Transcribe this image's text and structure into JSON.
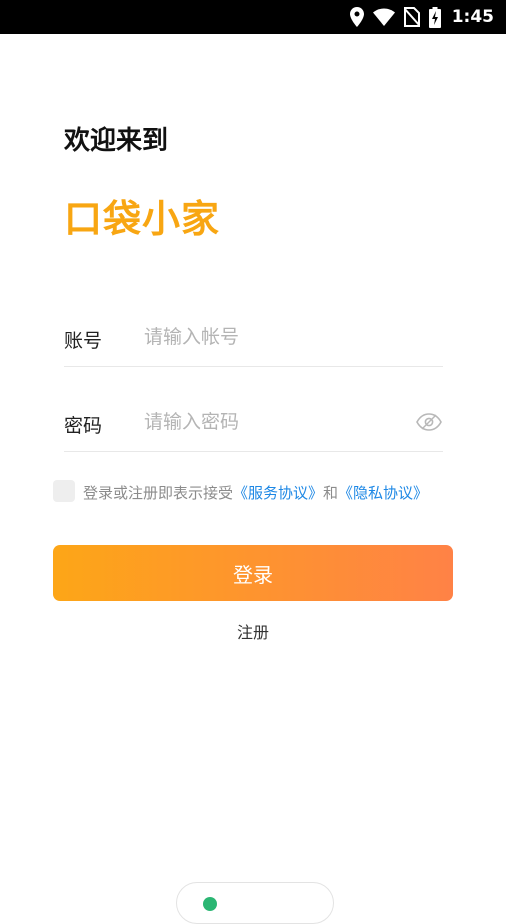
{
  "status_bar": {
    "time": "1:45",
    "icons": [
      "location-icon",
      "wifi-icon",
      "no-sim-icon",
      "battery-charging-icon"
    ]
  },
  "welcome_text": "欢迎来到",
  "app_name": "口袋小家",
  "form": {
    "account": {
      "label": "账号",
      "placeholder": "请输入帐号",
      "value": ""
    },
    "password": {
      "label": "密码",
      "placeholder": "请输入密码",
      "value": "",
      "visibility_icon": "eye-icon"
    }
  },
  "agreement": {
    "checked": false,
    "prefix": "登录或注册即表示接受",
    "service_link": "《服务协议》",
    "conjunction": "和",
    "privacy_link": "《隐私协议》"
  },
  "login_label": "登录",
  "register_label": "注册",
  "colors": {
    "brand": "#F8A612",
    "button_start": "#FDA617",
    "button_end": "#FF8246",
    "link": "#1E88E5",
    "placeholder": "#B4B4B4"
  }
}
